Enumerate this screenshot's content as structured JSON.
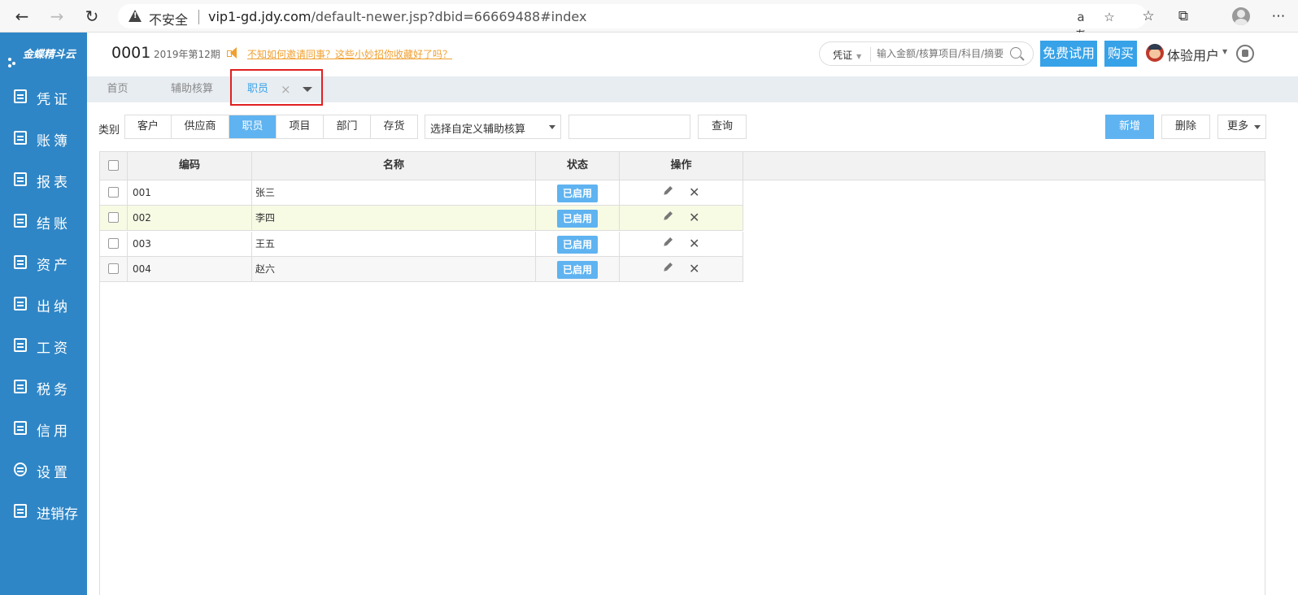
{
  "browser": {
    "insecure_label": "不安全",
    "url_host": "vip1-gd.jdy.com",
    "url_path": "/default-newer.jsp?dbid=66669488#index",
    "read_aloud_icon": "aあ"
  },
  "sidebar": {
    "logo": "金蝶精斗云",
    "items": [
      {
        "label": "凭证",
        "icon": "voucher-icon"
      },
      {
        "label": "账簿",
        "icon": "ledger-icon"
      },
      {
        "label": "报表",
        "icon": "report-icon"
      },
      {
        "label": "结账",
        "icon": "close-account-icon"
      },
      {
        "label": "资产",
        "icon": "asset-icon"
      },
      {
        "label": "出纳",
        "icon": "cashier-icon"
      },
      {
        "label": "工资",
        "icon": "salary-icon"
      },
      {
        "label": "税务",
        "icon": "tax-icon"
      },
      {
        "label": "信用",
        "icon": "credit-icon"
      },
      {
        "label": "设置",
        "icon": "settings-icon"
      },
      {
        "label": "进销存",
        "icon": "inventory-icon"
      }
    ]
  },
  "header": {
    "account_code": "0001",
    "period": "2019年第12期",
    "notice": "不知如何邀请同事？这些小妙招你收藏好了吗？",
    "search_type": "凭证",
    "search_placeholder": "输入金额/核算项目/科目/摘要",
    "trial_button": "免费试用",
    "buy_button": "购买",
    "user_name": "体验用户"
  },
  "tabs": [
    {
      "label": "首页",
      "active": false
    },
    {
      "label": "辅助核算",
      "active": false
    },
    {
      "label": "职员",
      "active": true
    }
  ],
  "toolbar": {
    "category_label": "类别",
    "categories": [
      "客户",
      "供应商",
      "职员",
      "项目",
      "部门",
      "存货"
    ],
    "active_category": "职员",
    "custom_select": "选择自定义辅助核算",
    "query_value": "",
    "query_button": "查询",
    "add_button": "新增",
    "delete_button": "删除",
    "more_button": "更多"
  },
  "grid": {
    "columns": [
      "编码",
      "名称",
      "状态",
      "操作"
    ],
    "rows": [
      {
        "code": "001",
        "name": "张三",
        "status": "已启用"
      },
      {
        "code": "002",
        "name": "李四",
        "status": "已启用"
      },
      {
        "code": "003",
        "name": "王五",
        "status": "已启用"
      },
      {
        "code": "004",
        "name": "赵六",
        "status": "已启用"
      }
    ]
  },
  "colors": {
    "sidebar": "#2f86c6",
    "accent": "#37a2e8",
    "badge": "#5fb3f0",
    "notice": "#f0a030",
    "highlight_row": "#f7fbe4",
    "annotation_box": "#e02020"
  }
}
